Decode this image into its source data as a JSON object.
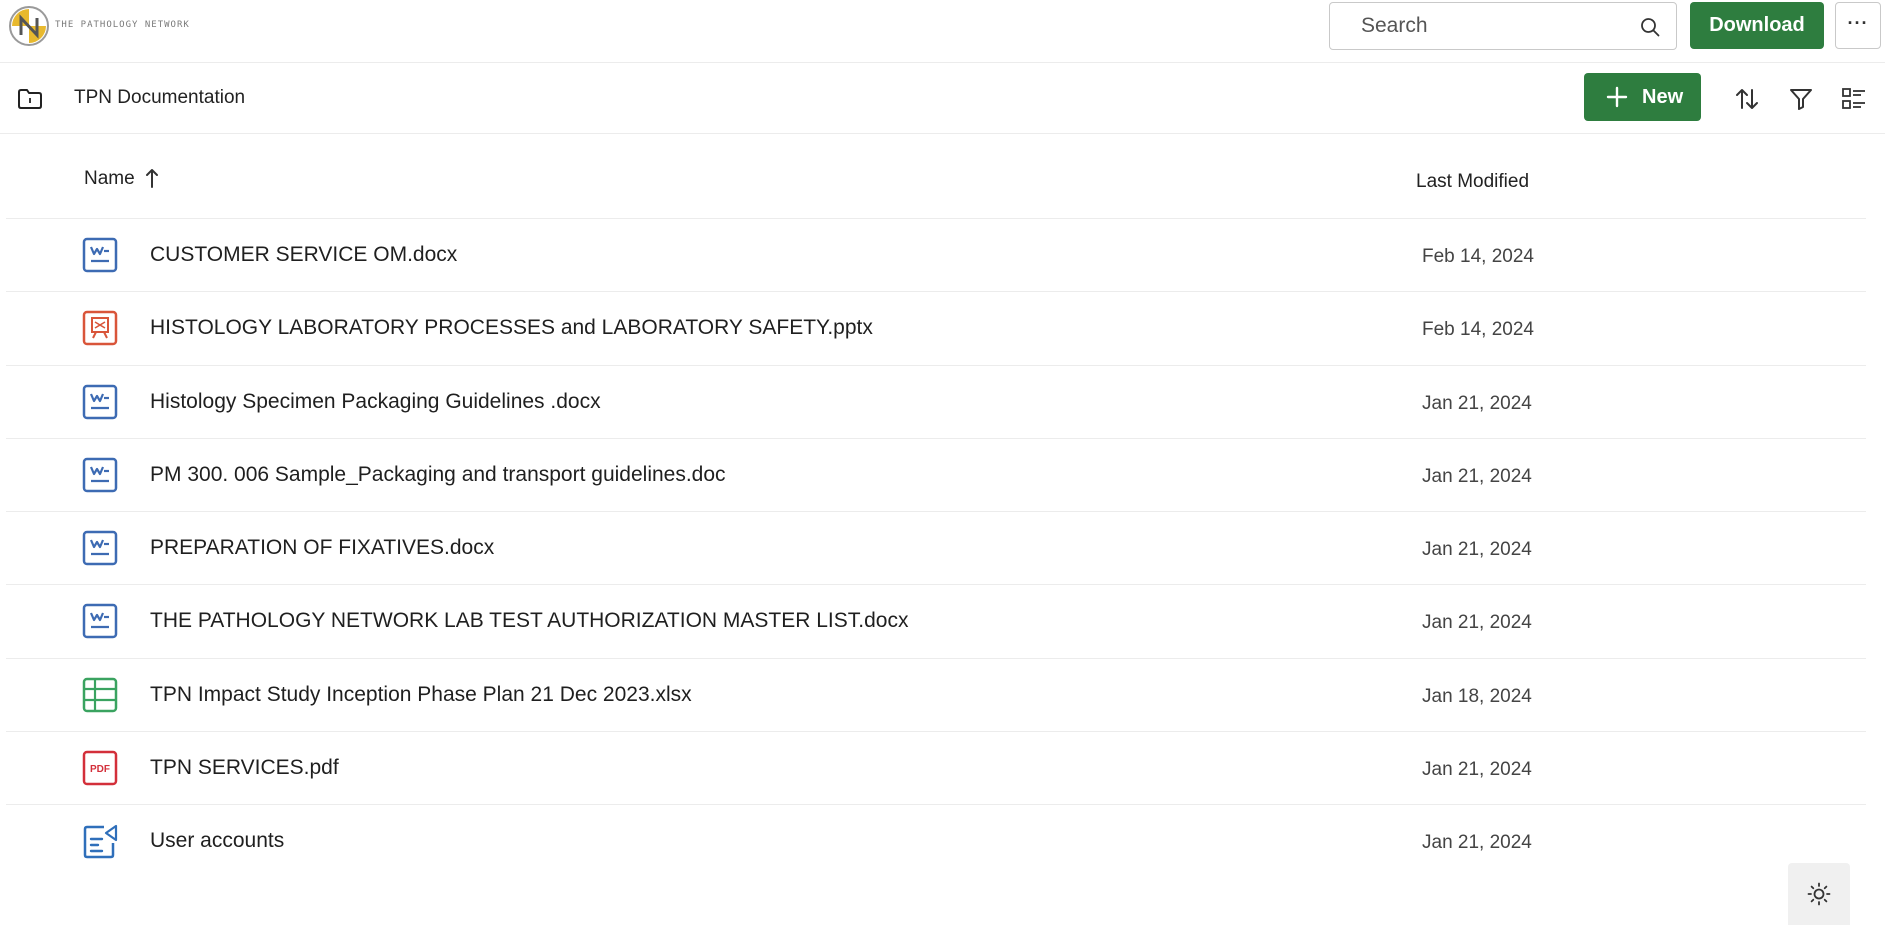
{
  "header": {
    "logo_text": "THE PATHOLOGY NETWORK",
    "search_placeholder": "Search",
    "download_label": "Download",
    "more_label": "···"
  },
  "toolbar": {
    "folder_title": "TPN Documentation",
    "new_label": "New"
  },
  "table": {
    "col_name": "Name",
    "col_modified": "Last Modified",
    "rows": [
      {
        "name": "CUSTOMER SERVICE OM.docx",
        "date": "Feb 14, 2024",
        "icon": "word-document-icon"
      },
      {
        "name": "HISTOLOGY LABORATORY PROCESSES and LABORATORY SAFETY.pptx",
        "date": "Feb 14, 2024",
        "icon": "powerpoint-icon"
      },
      {
        "name": "Histology Specimen Packaging Guidelines .docx",
        "date": "Jan 21, 2024",
        "icon": "word-document-icon"
      },
      {
        "name": "PM 300. 006 Sample_Packaging and transport guidelines.doc",
        "date": "Jan 21, 2024",
        "icon": "word-document-icon"
      },
      {
        "name": "PREPARATION OF FIXATIVES.docx",
        "date": "Jan 21, 2024",
        "icon": "word-document-icon"
      },
      {
        "name": "THE PATHOLOGY NETWORK LAB TEST AUTHORIZATION MASTER LIST.docx",
        "date": "Jan 21, 2024",
        "icon": "word-document-icon"
      },
      {
        "name": "TPN Impact Study Inception Phase Plan 21 Dec 2023.xlsx",
        "date": "Jan 18, 2024",
        "icon": "spreadsheet-icon"
      },
      {
        "name": "TPN SERVICES.pdf",
        "date": "Jan 21, 2024",
        "icon": "pdf-icon"
      },
      {
        "name": "User accounts",
        "date": "Jan 21, 2024",
        "icon": "form-icon"
      }
    ]
  },
  "colors": {
    "accent_green": "#2e7d3f",
    "word_blue": "#3d6bb3",
    "ppt_orange": "#d9553a",
    "excel_green": "#3aa360",
    "pdf_red": "#d32f3a"
  },
  "pdf_badge_text": "PDF"
}
